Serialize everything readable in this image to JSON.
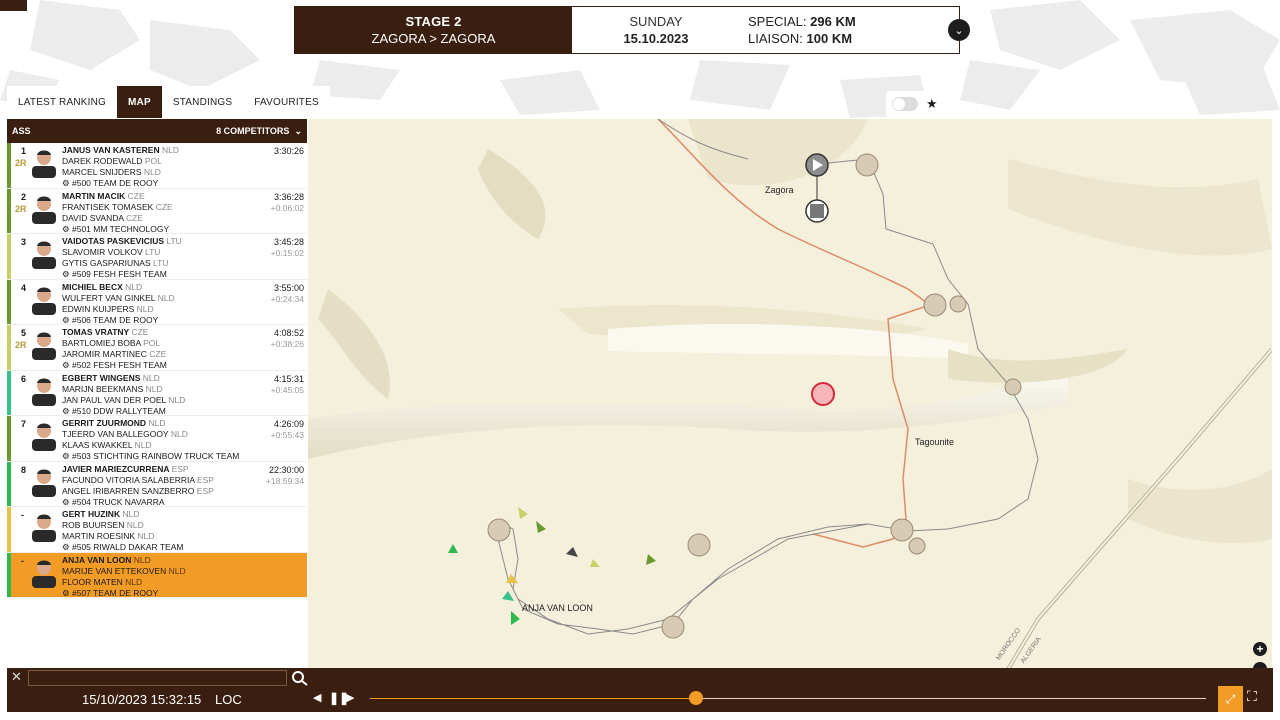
{
  "stage": {
    "title": "STAGE 2",
    "route": "ZAGORA > ZAGORA",
    "day": "SUNDAY",
    "date": "15.10.2023",
    "special_label": "SPECIAL:",
    "special_value": "296 KM",
    "liaison_label": "LIAISON:",
    "liaison_value": "100 KM"
  },
  "tabs": [
    "LATEST RANKING",
    "MAP",
    "STANDINGS",
    "FAVOURITES"
  ],
  "active_tab": "MAP",
  "sidebar": {
    "checkpoint": "ASS",
    "competitors": "8 COMPETITORS",
    "rows": [
      {
        "pos": "1",
        "badge": "2R",
        "bar_color": "#6a9a2f",
        "driver": "JANUS VAN KASTEREN",
        "driver_nat": "NLD",
        "co1": "DAREK RODEWALD",
        "co1_nat": "POL",
        "co2": "MARCEL SNIJDERS",
        "co2_nat": "NLD",
        "team": "#500 TEAM DE ROOY",
        "time": "3:30:26",
        "gap": ""
      },
      {
        "pos": "2",
        "badge": "2R",
        "bar_color": "#6a9a2f",
        "driver": "MARTIN MACIK",
        "driver_nat": "CZE",
        "co1": "FRANTISEK TOMASEK",
        "co1_nat": "CZE",
        "co2": "DAVID SVANDA",
        "co2_nat": "CZE",
        "team": "#501 MM TECHNOLOGY",
        "time": "3:36:28",
        "gap": "+0:06:02"
      },
      {
        "pos": "3",
        "badge": "",
        "bar_color": "#c6cf6a",
        "driver": "VAIDOTAS PASKEVICIUS",
        "driver_nat": "LTU",
        "co1": "SLAVOMIR VOLKOV",
        "co1_nat": "LTU",
        "co2": "GYTIS GASPARIUNAS",
        "co2_nat": "LTU",
        "team": "#509 FESH FESH TEAM",
        "time": "3:45:28",
        "gap": "+0:15:02"
      },
      {
        "pos": "4",
        "badge": "",
        "bar_color": "#6a9a2f",
        "driver": "MICHIEL BECX",
        "driver_nat": "NLD",
        "co1": "WULFERT VAN GINKEL",
        "co1_nat": "NLD",
        "co2": "EDWIN KUIJPERS",
        "co2_nat": "NLD",
        "team": "#506 TEAM DE ROOY",
        "time": "3:55:00",
        "gap": "+0:24:34"
      },
      {
        "pos": "5",
        "badge": "2R",
        "bar_color": "#c6cf6a",
        "driver": "TOMAS VRATNY",
        "driver_nat": "CZE",
        "co1": "BARTLOMIEJ BOBA",
        "co1_nat": "POL",
        "co2": "JAROMIR MARTINEC",
        "co2_nat": "CZE",
        "team": "#502 FESH FESH TEAM",
        "time": "4:08:52",
        "gap": "+0:38:26"
      },
      {
        "pos": "6",
        "badge": "",
        "bar_color": "#37c08a",
        "driver": "EGBERT WINGENS",
        "driver_nat": "NLD",
        "co1": "MARIJN BEEKMANS",
        "co1_nat": "NLD",
        "co2": "JAN PAUL VAN DER POEL",
        "co2_nat": "NLD",
        "team": "#510 DDW RALLYTEAM",
        "time": "4:15:31",
        "gap": "+0:45:05"
      },
      {
        "pos": "7",
        "badge": "",
        "bar_color": "#6a9a2f",
        "driver": "GERRIT ZUURMOND",
        "driver_nat": "NLD",
        "co1": "TJEERD VAN BALLEGOOY",
        "co1_nat": "NLD",
        "co2": "KLAAS KWAKKEL",
        "co2_nat": "NLD",
        "team": "#503 STICHTING RAINBOW TRUCK TEAM",
        "time": "4:26:09",
        "gap": "+0:55:43"
      },
      {
        "pos": "8",
        "badge": "",
        "bar_color": "#2fb84e",
        "driver": "JAVIER MARIEZCURRENA",
        "driver_nat": "ESP",
        "co1": "FACUNDO VITORIA SALABERRIA",
        "co1_nat": "ESP",
        "co2": "ANGEL IRIBARREN SANZBERRO",
        "co2_nat": "ESP",
        "team": "#504 TRUCK NAVARRA",
        "time": "22:30:00",
        "gap": "+18:59:34"
      },
      {
        "pos": "-",
        "badge": "",
        "bar_color": "#e9c24a",
        "driver": "GERT HUZINK",
        "driver_nat": "NLD",
        "co1": "ROB BUURSEN",
        "co1_nat": "NLD",
        "co2": "MARTIN ROESINK",
        "co2_nat": "NLD",
        "team": "#505 RIWALD DAKAR TEAM",
        "time": "",
        "gap": ""
      },
      {
        "pos": "-",
        "badge": "",
        "bar_color": "#2fb84e",
        "driver": "ANJA VAN LOON",
        "driver_nat": "NLD",
        "co1": "MARIJE VAN ETTEKOVEN",
        "co1_nat": "NLD",
        "co2": "FLOOR MATEN",
        "co2_nat": "NLD",
        "team": "#507 TEAM DE ROOY",
        "time": "",
        "gap": "",
        "selected": true
      }
    ]
  },
  "map": {
    "labels": {
      "zagora": "Zagora",
      "tagounite": "Tagounite",
      "selected_vehicle": "ANJA VAN LOON",
      "morocco": "MOROCCO",
      "algeria": "ALGERIA"
    }
  },
  "playback": {
    "datetime": "15/10/2023 15:32:15",
    "timezone": "LOC",
    "progress_percent": 39
  },
  "colors": {
    "brand_dark": "#3a1f10",
    "accent": "#f29b25",
    "route": "#e08a6a",
    "track": "#8a8a8a"
  }
}
